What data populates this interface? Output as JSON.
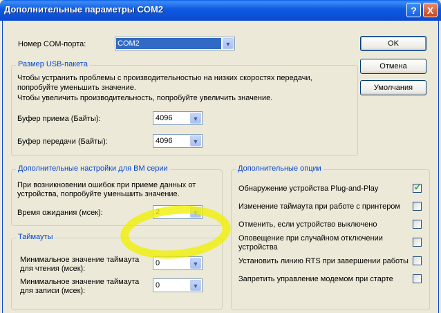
{
  "window": {
    "title": "Дополнительные параметры COM2",
    "help": "?",
    "close": "X"
  },
  "port": {
    "label": "Номер COM-порта:",
    "value": "COM2"
  },
  "usb": {
    "legend": "Размер USB-пакета",
    "desc1": "Чтобы устранить проблемы с производительностью на низких скоростях передачи,",
    "desc2": "попробуйте уменьшить значение.",
    "desc3": "Чтобы увеличить производительность, попробуйте увеличить значение.",
    "rx_label": "Буфер приема (Байты):",
    "rx_value": "4096",
    "tx_label": "Буфер передачи (Байты):",
    "tx_value": "4096"
  },
  "bm": {
    "legend": "Дополнительные настройки для BM серии",
    "desc1": "При возникновении ошибок при приеме данных от",
    "desc2": "устройства, попробуйте уменьшить значение.",
    "latency_label": "Время ожидания (мсек):",
    "latency_value": "2"
  },
  "timeouts": {
    "legend": "Таймауты",
    "read_label1": "Минимальное значение таймаута",
    "read_label2": "для чтения (мсек):",
    "read_value": "0",
    "write_label1": "Минимальное значение таймаута",
    "write_label2": "для записи (мсек):",
    "write_value": "0"
  },
  "options": {
    "legend": "Дополнительные опции",
    "items": [
      {
        "label": "Обнаружение устройства Plug-and-Play",
        "checked": true
      },
      {
        "label": "Изменение таймаута при работе с принтером",
        "checked": false
      },
      {
        "label": "Отменить, если устройство выключено",
        "checked": false
      },
      {
        "label1": "Оповещение при случайном отключении",
        "label2": "устройства",
        "checked": false
      },
      {
        "label": "Установить линию RTS при завершении работы",
        "checked": false
      },
      {
        "label": "Запретить управление модемом при старте",
        "checked": false
      }
    ]
  },
  "buttons": {
    "ok": "OK",
    "cancel": "Отмена",
    "defaults": "Умолчания"
  },
  "colors": {
    "title_bar": "#0b49cf",
    "highlight": "#f0f000",
    "group_legend": "#0046d5"
  }
}
